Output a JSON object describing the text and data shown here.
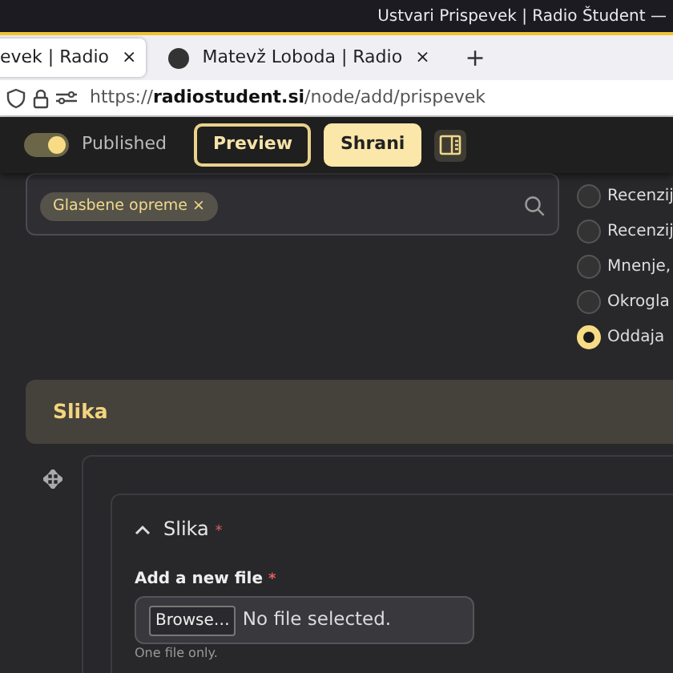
{
  "window": {
    "title": "Ustvari Prispevek | Radio Študent —"
  },
  "browser_tabs": [
    {
      "label": "evek | Radio",
      "close": "×",
      "selected": true
    },
    {
      "label": "Matevž Loboda | Radio",
      "close": "×",
      "selected": false
    }
  ],
  "new_tab": "+",
  "address_bar": {
    "scheme": "https://",
    "domain": "radiostudent.si",
    "path": "/node/add/prispevek"
  },
  "toolbar": {
    "published": {
      "label": "Published",
      "on": true
    },
    "buttons": [
      {
        "label": "Preview",
        "kind": "outline"
      },
      {
        "label": "Shrani",
        "kind": "primary"
      }
    ]
  },
  "tags_field": {
    "tags": [
      {
        "label": "Glasbene opreme",
        "remove": "×"
      }
    ]
  },
  "radio_options": [
    {
      "label": "Recenzij",
      "selected": false
    },
    {
      "label": "Recenzij",
      "selected": false
    },
    {
      "label": "Mnenje,",
      "selected": false
    },
    {
      "label": "Okrogla",
      "selected": false
    },
    {
      "label": "Oddaja",
      "selected": true
    }
  ],
  "section": {
    "title": "Slika"
  },
  "image_widget": {
    "title": "Slika",
    "required_mark": "*",
    "expanded": true,
    "file_label": "Add a new file",
    "file_required_mark": "*",
    "browse": "Browse…",
    "file_status": "No file selected.",
    "hint": "One file only."
  }
}
